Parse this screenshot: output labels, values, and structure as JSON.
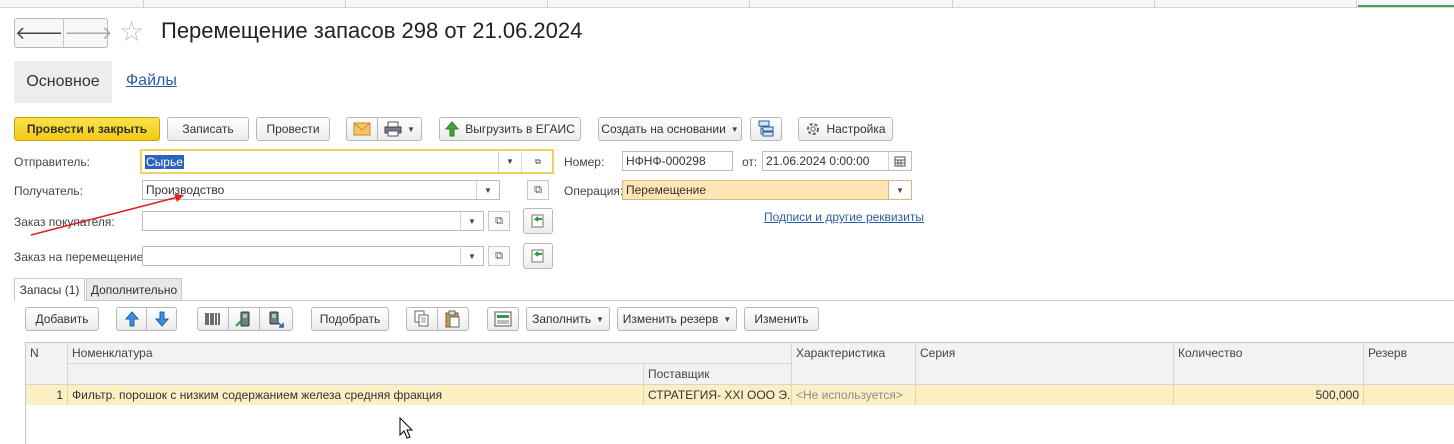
{
  "window": {
    "title": "Перемещение запасов 298 от 21.06.2024"
  },
  "nav": {
    "back": "🡐",
    "forward": "🡒",
    "star": "☆"
  },
  "tabs": {
    "main": "Основное",
    "files": "Файлы"
  },
  "toolbar": {
    "post_close": "Провести и закрыть",
    "save": "Записать",
    "post": "Провести",
    "export_egais": "Выгрузить в ЕГАИС",
    "create_based": "Создать на основании",
    "settings": "Настройка"
  },
  "form": {
    "sender_label": "Отправитель:",
    "sender_value": "Сырье",
    "receiver_label": "Получатель:",
    "receiver_value": "Производство",
    "customer_order_label": "Заказ покупателя:",
    "customer_order_value": "",
    "move_order_label": "Заказ на перемещение:",
    "move_order_value": "",
    "number_label": "Номер:",
    "number_value": "НФНФ-000298",
    "date_label": "от:",
    "date_value": "21.06.2024  0:00:00",
    "operation_label": "Операция:",
    "operation_value": "Перемещение",
    "signatures_link": "Подписи и другие реквизиты"
  },
  "subtabs": {
    "stocks": "Запасы (1)",
    "additional": "Дополнительно"
  },
  "table_toolbar": {
    "add": "Добавить",
    "pick": "Подобрать",
    "fill": "Заполнить",
    "change_reserve": "Изменить резерв",
    "change": "Изменить"
  },
  "table": {
    "headers": {
      "n": "N",
      "nomenclature": "Номенклатура",
      "supplier": "Поставщик",
      "characteristic": "Характеристика",
      "series": "Серия",
      "quantity": "Количество",
      "reserve": "Резерв"
    },
    "rows": [
      {
        "n": "1",
        "nomenclature": "Фильтр. порошок с низким содержанием железа средняя фракция",
        "supplier": "СТРАТЕГИЯ- XXI ООО Э...",
        "characteristic": "<Не используется>",
        "series": "",
        "quantity": "500,000",
        "reserve": ""
      }
    ]
  },
  "colors": {
    "accent_button": "#f3c914",
    "operation_field": "#fde5b5",
    "selected_row": "#fbefc3",
    "link": "#2a5d9f",
    "arrow_annotation": "#d9241f"
  },
  "icons": [
    "arrow-left-icon",
    "arrow-right-icon",
    "star-icon",
    "mail-icon",
    "printer-icon",
    "upload-arrow-icon",
    "structure-icon",
    "gear-icon",
    "arrow-up-icon",
    "arrow-down-icon",
    "barcode-icon",
    "scanner-icon",
    "copy-icon",
    "paste-icon",
    "fill-icon",
    "open-icon",
    "cursor-icon"
  ]
}
